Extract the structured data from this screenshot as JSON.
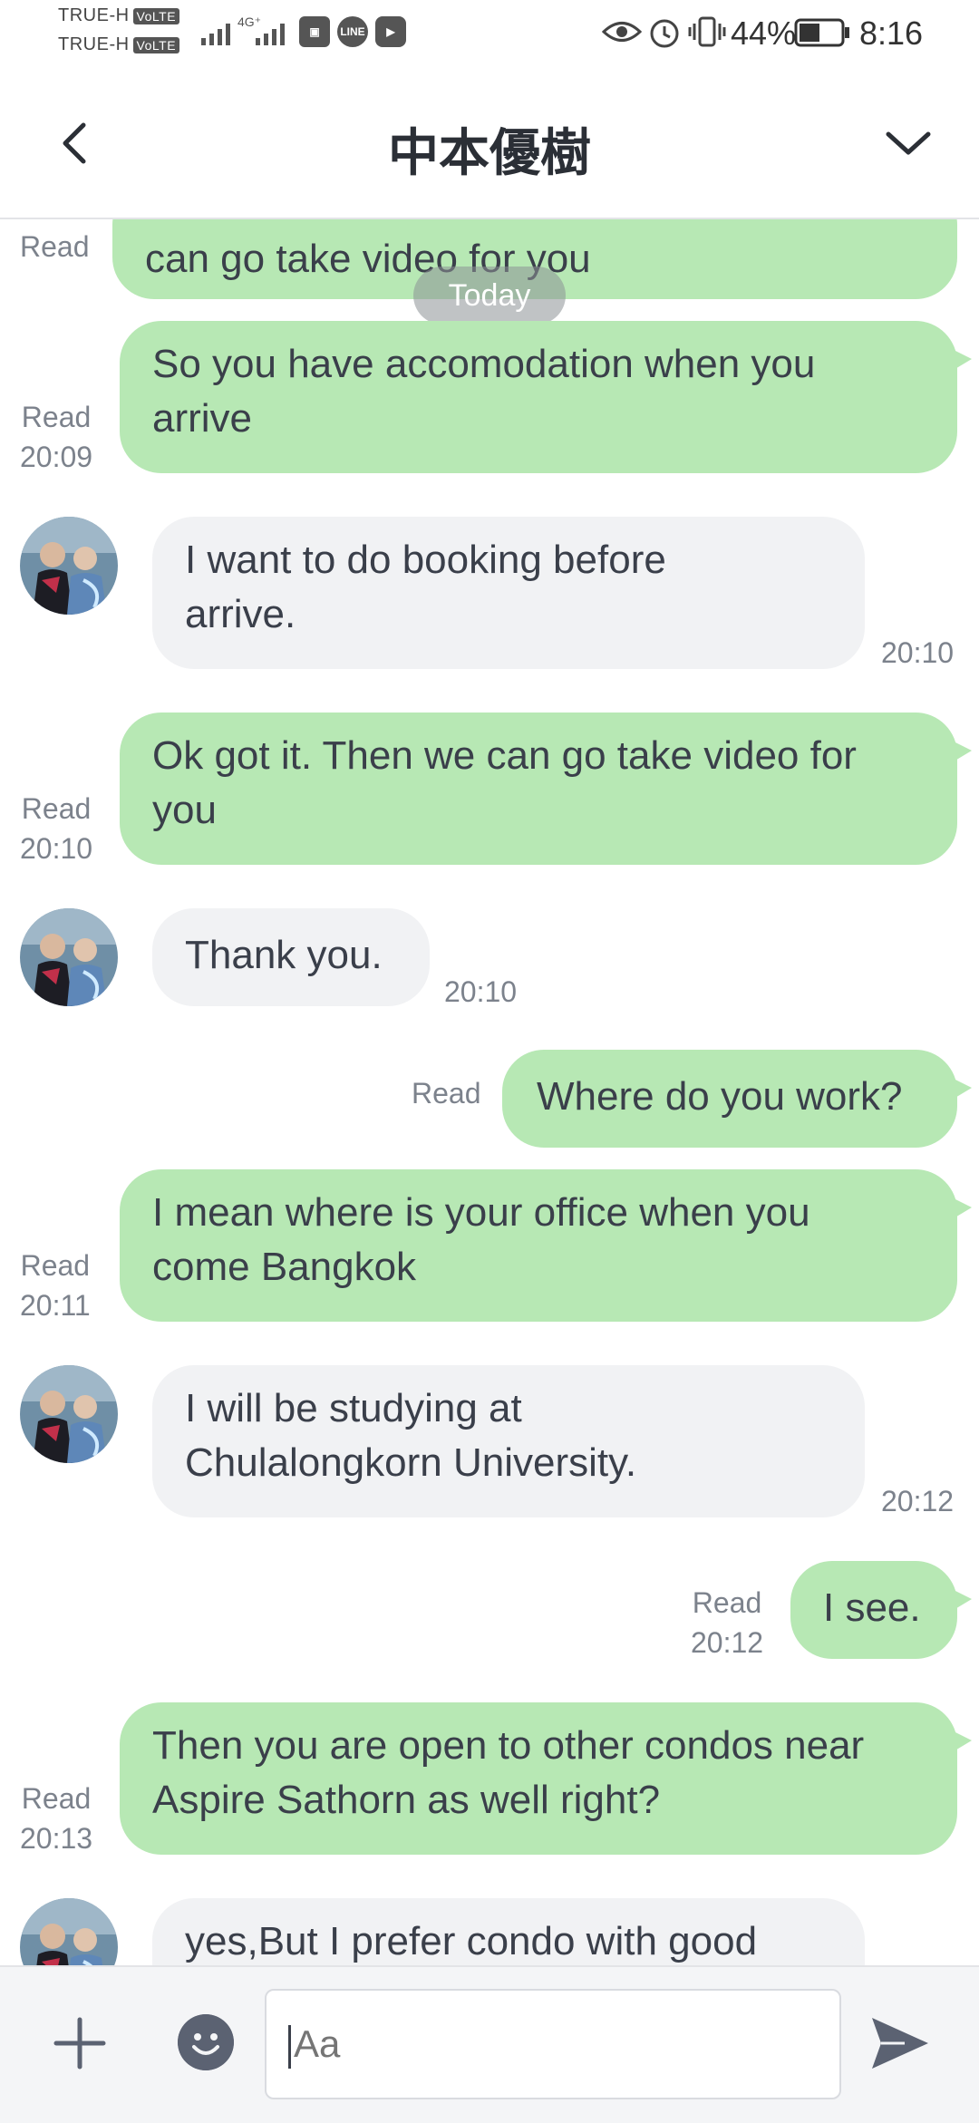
{
  "status_bar": {
    "carrier1": "TRUE-H",
    "carrier2": "TRUE-H",
    "volte": "VoLTE",
    "network": "4G⁺",
    "battery": "44%",
    "time": "8:16",
    "icons": [
      "signal-icon",
      "line-app-icon",
      "youtube-icon",
      "eye-icon",
      "alarm-icon",
      "vibrate-icon",
      "battery-icon"
    ]
  },
  "header": {
    "title": "中本優樹",
    "back_icon": "chevron-left-icon",
    "menu_icon": "chevron-down-icon"
  },
  "chat": {
    "date_badge": "Today",
    "messages": [
      {
        "side": "out",
        "lines": [
          "can go take video for you"
        ],
        "status": "Read",
        "time": ""
      },
      {
        "side": "out",
        "lines": [
          "So you have accomodation when you",
          "arrive"
        ],
        "status": "Read",
        "time": "20:09"
      },
      {
        "side": "in",
        "lines": [
          "I want to do booking before",
          "arrive."
        ],
        "time": "20:10"
      },
      {
        "side": "out",
        "lines": [
          "Ok got it. Then we can go take video for",
          "you"
        ],
        "status": "Read",
        "time": "20:10"
      },
      {
        "side": "in",
        "lines": [
          "Thank you."
        ],
        "time": "20:10"
      },
      {
        "side": "out",
        "lines": [
          "Where do you work?"
        ],
        "status": "Read",
        "time": ""
      },
      {
        "side": "out",
        "lines": [
          "I mean where is your office when you",
          "come Bangkok"
        ],
        "status": "Read",
        "time": "20:11"
      },
      {
        "side": "in",
        "lines": [
          "I will be studying at",
          "Chulalongkorn University."
        ],
        "time": "20:12"
      },
      {
        "side": "out",
        "lines": [
          "I see."
        ],
        "status": "Read",
        "time": "20:12"
      },
      {
        "side": "out",
        "lines": [
          "Then you are open to other condos near",
          "Aspire Sathorn as well right?"
        ],
        "status": "Read",
        "time": "20:13"
      },
      {
        "side": "in",
        "lines": [
          "yes,But I prefer condo with good"
        ],
        "time": ""
      }
    ]
  },
  "input": {
    "placeholder": "Aa"
  },
  "colors": {
    "outgoing_bubble": "#b7e8b4",
    "incoming_bubble": "#f1f2f4",
    "text": "#3a3f4a",
    "meta": "#7c828c"
  }
}
